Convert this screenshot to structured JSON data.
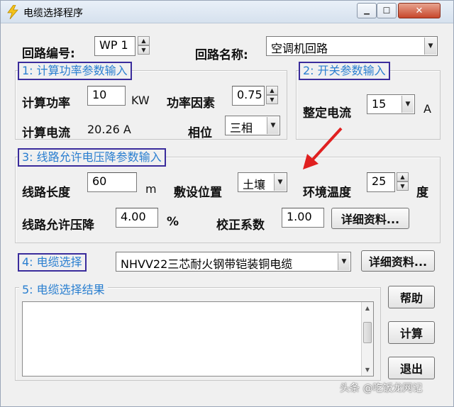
{
  "window": {
    "title": "电缆选择程序",
    "min_label": "▁",
    "max_label": "☐",
    "close_label": "✕"
  },
  "circuit": {
    "number_label": "回路编号:",
    "number_value": "WP 1",
    "name_label": "回路名称:",
    "name_value": "空调机回路"
  },
  "group1": {
    "title": "1: 计算功率参数输入",
    "power_label": "计算功率",
    "power_value": "10",
    "power_unit": "KW",
    "factor_label": "功率因素",
    "factor_value": "0.75",
    "current_label": "计算电流",
    "current_value": "20.26 A",
    "phase_label": "相位",
    "phase_value": "三相"
  },
  "group2": {
    "title": "2: 开关参数输入",
    "setting_label": "整定电流",
    "setting_value": "15",
    "setting_unit": "A"
  },
  "group3": {
    "title": "3: 线路允许电压降参数输入",
    "length_label": "线路长度",
    "length_value": "60",
    "length_unit": "m",
    "laying_label": "敷设位置",
    "laying_value": "土壤",
    "temp_label": "环境温度",
    "temp_value": "25",
    "temp_unit": "度",
    "drop_label": "线路允许压降",
    "drop_value": "4.00",
    "drop_unit": "%",
    "coef_label": "校正系数",
    "coef_value": "1.00",
    "details_label": "详细资料..."
  },
  "group4": {
    "title": "4: 电缆选择",
    "cable_value": "NHVV22三芯耐火钢带铠装铜电缆",
    "details_label": "详细资料..."
  },
  "group5": {
    "title": "5: 电缆选择结果"
  },
  "buttons": {
    "help": "帮助",
    "calc": "计算",
    "exit": "退出"
  },
  "watermark": "头条 @吃饭龙网记",
  "colors": {
    "group_title_text": "#2a7fd0",
    "group_title_border": "#3a2c9c",
    "annotation_arrow": "#e02020"
  }
}
